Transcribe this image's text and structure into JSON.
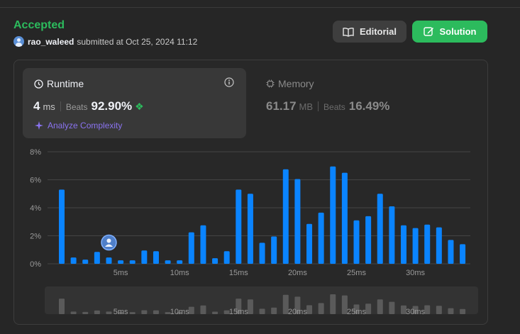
{
  "header": {
    "status": "Accepted",
    "username": "rao_waleed",
    "submitted_text": "submitted at Oct 25, 2024 11:12",
    "editorial_label": "Editorial",
    "solution_label": "Solution"
  },
  "runtime": {
    "title": "Runtime",
    "value": "4",
    "unit": "ms",
    "beats_label": "Beats",
    "beats_value": "92.90%",
    "analyze_label": "Analyze Complexity"
  },
  "memory": {
    "title": "Memory",
    "value": "61.17",
    "unit": "MB",
    "beats_label": "Beats",
    "beats_value": "16.49%"
  },
  "colors": {
    "accepted": "#2cbb5d",
    "bar": "#0a84ff",
    "analyze": "#8a73f0",
    "overview_bar": "#5a5a5a"
  },
  "chart_data": {
    "type": "bar",
    "ylim": [
      0,
      8
    ],
    "yticks": [
      "0%",
      "2%",
      "4%",
      "6%",
      "8%"
    ],
    "ytick_values": [
      0,
      2,
      4,
      6,
      8
    ],
    "xtick_labels": [
      "5ms",
      "10ms",
      "15ms",
      "20ms",
      "25ms",
      "30ms"
    ],
    "xtick_values": [
      5,
      10,
      15,
      20,
      25,
      30
    ],
    "x": [
      0,
      1,
      2,
      3,
      4,
      5,
      6,
      7,
      8,
      9,
      10,
      11,
      12,
      13,
      14,
      15,
      16,
      17,
      18,
      19,
      20,
      21,
      22,
      23,
      24,
      25,
      26,
      27,
      28,
      29,
      30,
      31,
      32,
      33,
      34
    ],
    "values": [
      5.3,
      0.45,
      0.3,
      0.85,
      0.45,
      0.25,
      0.25,
      0.95,
      0.9,
      0.25,
      0.25,
      2.25,
      2.75,
      0.4,
      0.9,
      5.3,
      5.0,
      1.5,
      1.95,
      6.75,
      6.05,
      2.85,
      3.65,
      6.95,
      6.5,
      3.1,
      3.4,
      5.0,
      4.1,
      2.75,
      2.55,
      2.8,
      2.6,
      1.7,
      1.4
    ],
    "highlight_x": 4
  }
}
